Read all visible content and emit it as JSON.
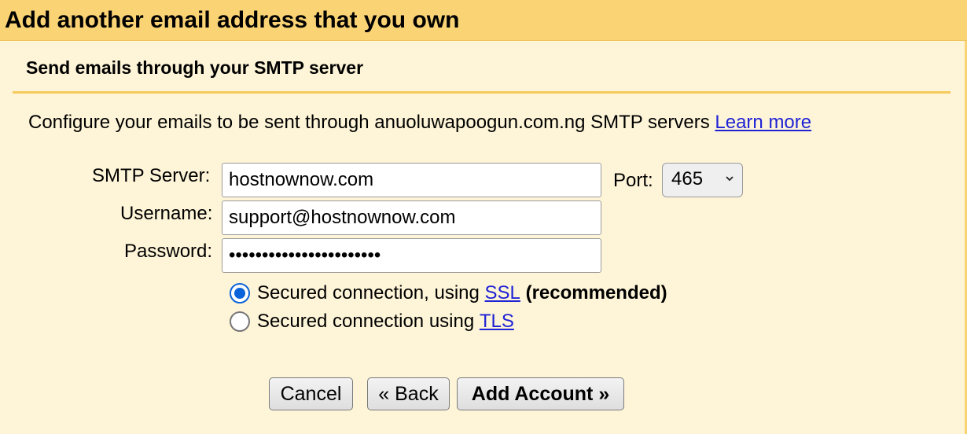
{
  "header": {
    "title": "Add another email address that you own"
  },
  "section": {
    "title": "Send emails through your SMTP server"
  },
  "intro": {
    "text": "Configure your emails to be sent through anuoluwapoogun.com.ng SMTP servers",
    "link_label": "Learn more"
  },
  "form": {
    "smtp_server_label": "SMTP Server:",
    "smtp_server_value": "hostnownow.com",
    "port_label": "Port:",
    "port_value": "465",
    "username_label": "Username:",
    "username_value": "support@hostnownow.com",
    "password_label": "Password:",
    "password_value": "•••••••••••••••••••••••"
  },
  "security": {
    "ssl": {
      "text": "Secured connection, using",
      "link_label": "SSL",
      "suffix": "(recommended)",
      "checked": true
    },
    "tls": {
      "text": "Secured connection using",
      "link_label": "TLS",
      "checked": false
    }
  },
  "buttons": {
    "cancel": "Cancel",
    "back": "« Back",
    "add_account": "Add Account »"
  },
  "colors": {
    "header_bg": "#fad374",
    "panel_bg": "#fef5d8",
    "link": "#1f22d6",
    "radio_accent": "#0a63d8"
  }
}
